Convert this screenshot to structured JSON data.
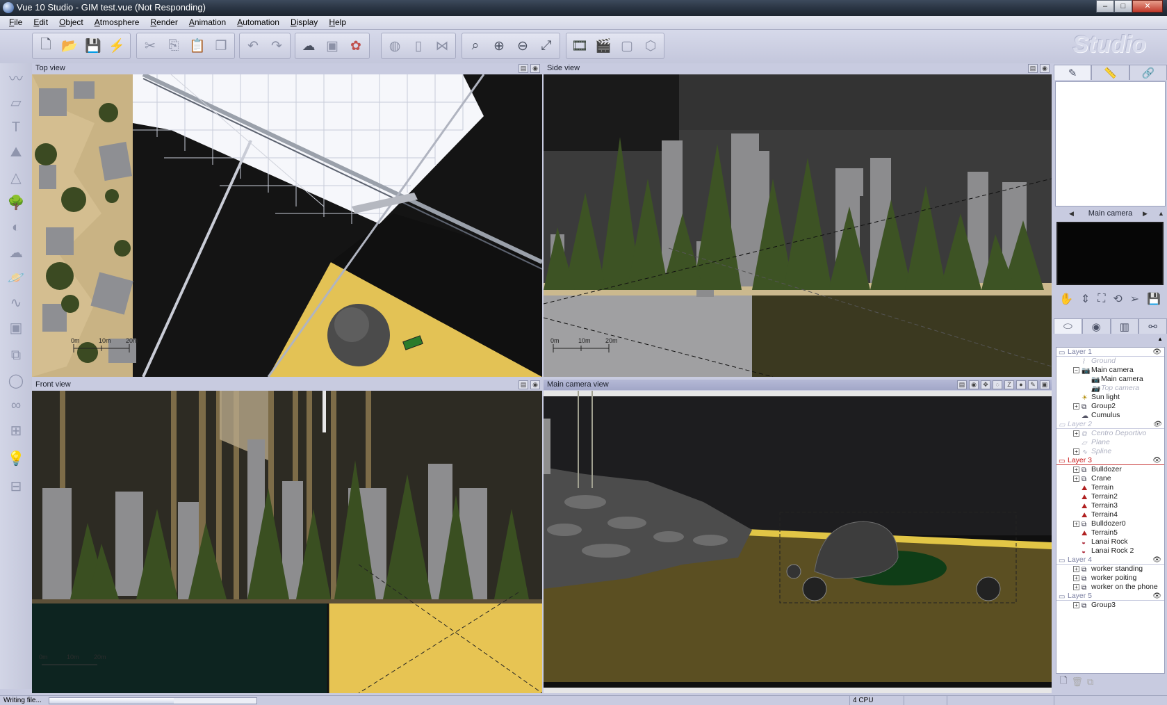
{
  "window": {
    "title": "Vue 10 Studio - GIM test.vue (Not Responding)",
    "minimize": "–",
    "maximize": "□",
    "close": "✕"
  },
  "menu": [
    "File",
    "Edit",
    "Object",
    "Atmosphere",
    "Render",
    "Animation",
    "Automation",
    "Display",
    "Help"
  ],
  "toolbar": {
    "groups": [
      [
        "new-document-icon",
        "open-folder-icon",
        "save-icon",
        "save-incremental-icon"
      ],
      [
        "cut-icon",
        "copy-icon",
        "paste-icon",
        "duplicate-icon"
      ],
      [
        "undo-icon",
        "redo-icon"
      ],
      [
        "load-atmosphere-icon",
        "load-object-icon",
        "material-icon"
      ],
      [
        "globe-icon",
        "bookmark-icon",
        "flip-icon"
      ],
      [
        "zoom-select-icon",
        "zoom-in-icon",
        "zoom-out-icon",
        "zoom-fit-icon"
      ],
      [
        "render-film-icon",
        "clapper-icon",
        "render-area-icon",
        "object-properties-icon"
      ]
    ],
    "logo": "Studio"
  },
  "left_tools": [
    "wave-icon",
    "plane-icon",
    "text-tool-icon",
    "terrain-icon",
    "symmetric-terrain-icon",
    "tree-icon",
    "rock-icon",
    "cloud-icon",
    "planet-icon",
    "spline-icon",
    "cube-icon",
    "group-icon",
    "sphere-tool-icon",
    "metablob-icon",
    "boolean-icon",
    "light-icon",
    "hyperblob-icon"
  ],
  "viewports": {
    "top": {
      "title": "Top view",
      "scale": [
        "0m",
        "10m",
        "20m"
      ]
    },
    "side": {
      "title": "Side view",
      "scale": [
        "0m",
        "10m",
        "20m"
      ]
    },
    "front": {
      "title": "Front view",
      "scale": [
        "0m",
        "10m",
        "20m"
      ]
    },
    "camera": {
      "title": "Main camera view"
    }
  },
  "right_panel": {
    "tabs": [
      "brush-icon",
      "ruler-icon",
      "link-icon"
    ],
    "camera_label": "Main camera",
    "world_tabs": [
      "objects-icon",
      "materials-icon",
      "links-icon",
      "filters-icon"
    ],
    "tree": [
      {
        "type": "layer",
        "label": "Layer 1",
        "state": "normal",
        "eye": true
      },
      {
        "type": "item",
        "label": "Ground",
        "indent": 1,
        "icon": "ground-icon",
        "dim": true,
        "expander": false
      },
      {
        "type": "item",
        "label": "Main camera",
        "indent": 1,
        "icon": "camera-icon",
        "dim": false,
        "expander": true,
        "open": true
      },
      {
        "type": "item",
        "label": "Main camera",
        "indent": 2,
        "icon": "camera-icon",
        "dim": false,
        "expander": false
      },
      {
        "type": "item",
        "label": "Top camera",
        "indent": 2,
        "icon": "camera-icon",
        "dim": true,
        "expander": false
      },
      {
        "type": "item",
        "label": "Sun light",
        "indent": 1,
        "icon": "sun-icon",
        "dim": false,
        "expander": false
      },
      {
        "type": "item",
        "label": "Group2",
        "indent": 1,
        "icon": "group-icon",
        "dim": false,
        "expander": true
      },
      {
        "type": "item",
        "label": "Cumulus",
        "indent": 1,
        "icon": "cloud-icon",
        "dim": false,
        "expander": false
      },
      {
        "type": "layer",
        "label": "Layer 2",
        "state": "dim",
        "eye": true
      },
      {
        "type": "item",
        "label": "Centro Deportivo",
        "indent": 1,
        "icon": "group-icon",
        "dim": true,
        "expander": true
      },
      {
        "type": "item",
        "label": "Plane",
        "indent": 1,
        "icon": "plane-icon",
        "dim": true,
        "expander": false
      },
      {
        "type": "item",
        "label": "Spline",
        "indent": 1,
        "icon": "spline-icon",
        "dim": true,
        "expander": true
      },
      {
        "type": "layer",
        "label": "Layer 3",
        "state": "sel",
        "eye": true
      },
      {
        "type": "item",
        "label": "Bulldozer",
        "indent": 1,
        "icon": "group-icon",
        "dim": false,
        "expander": true
      },
      {
        "type": "item",
        "label": "Crane",
        "indent": 1,
        "icon": "group-icon",
        "dim": false,
        "expander": true
      },
      {
        "type": "item",
        "label": "Terrain",
        "indent": 1,
        "icon": "terrain-icon",
        "dim": false,
        "expander": false
      },
      {
        "type": "item",
        "label": "Terrain2",
        "indent": 1,
        "icon": "terrain-icon",
        "dim": false,
        "expander": false
      },
      {
        "type": "item",
        "label": "Terrain3",
        "indent": 1,
        "icon": "terrain-icon",
        "dim": false,
        "expander": false
      },
      {
        "type": "item",
        "label": "Terrain4",
        "indent": 1,
        "icon": "terrain-icon",
        "dim": false,
        "expander": false
      },
      {
        "type": "item",
        "label": "Bulldozer0",
        "indent": 1,
        "icon": "group-icon",
        "dim": false,
        "expander": true
      },
      {
        "type": "item",
        "label": "Terrain5",
        "indent": 1,
        "icon": "terrain-icon",
        "dim": false,
        "expander": false
      },
      {
        "type": "item",
        "label": "Lanai Rock",
        "indent": 1,
        "icon": "rock-icon",
        "dim": false,
        "expander": false
      },
      {
        "type": "item",
        "label": "Lanai Rock 2",
        "indent": 1,
        "icon": "rock-icon",
        "dim": false,
        "expander": false
      },
      {
        "type": "layer",
        "label": "Layer 4",
        "state": "normal",
        "eye": true
      },
      {
        "type": "item",
        "label": "worker standing",
        "indent": 1,
        "icon": "group-icon",
        "dim": false,
        "expander": true
      },
      {
        "type": "item",
        "label": "worker poiting",
        "indent": 1,
        "icon": "group-icon",
        "dim": false,
        "expander": true
      },
      {
        "type": "item",
        "label": "worker on the phone",
        "indent": 1,
        "icon": "group-icon",
        "dim": false,
        "expander": true
      },
      {
        "type": "layer",
        "label": "Layer 5",
        "state": "normal",
        "eye": true
      },
      {
        "type": "item",
        "label": "Group3",
        "indent": 1,
        "icon": "group-icon",
        "dim": false,
        "expander": true
      }
    ]
  },
  "status": {
    "text": "Writing file...",
    "progress": 0.6,
    "cpu": "4 CPU"
  }
}
